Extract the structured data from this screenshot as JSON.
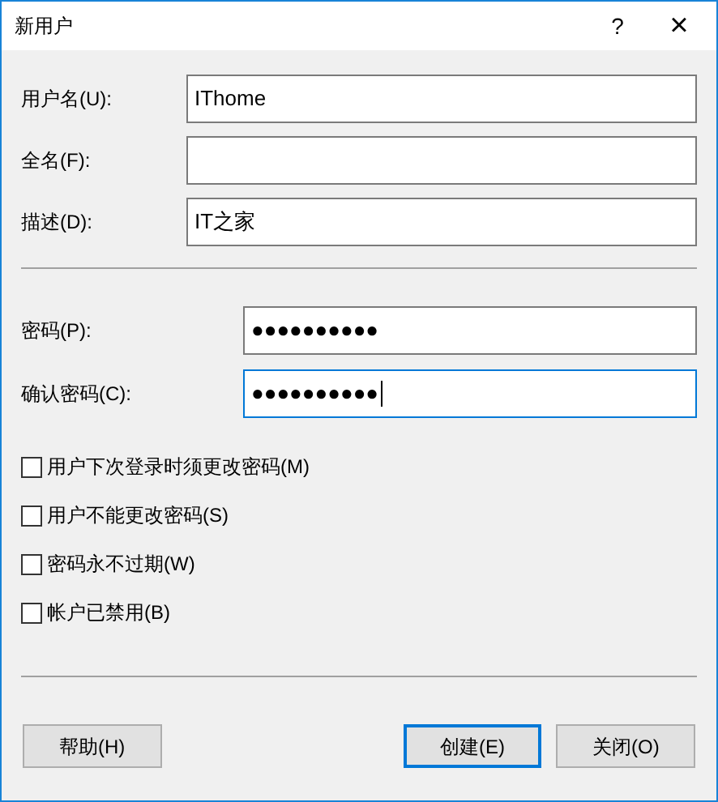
{
  "window": {
    "title": "新用户",
    "help_button": "?",
    "close_button": "×"
  },
  "account_fields": [
    {
      "label": "用户名(U):",
      "value": "IThome",
      "focused": false
    },
    {
      "label": "全名(F):",
      "focused": false
    },
    {
      "label": "描述(D):",
      "value": "IT之家",
      "focused": false
    }
  ],
  "password_fields": [
    {
      "label": "密码(P):",
      "value": "●●●●●●●●●●",
      "focused": false
    },
    {
      "label": "确认密码(C):",
      "value": "●●●●●●●●●●",
      "focused": true
    }
  ],
  "options": [
    {
      "label": "用户下次登录时须更改密码(M)",
      "checked": false
    },
    {
      "label": "用户不能更改密码(S)",
      "checked": false
    },
    {
      "label": "密码永不过期(W)",
      "checked": false
    },
    {
      "label": "帐户已禁用(B)",
      "checked": false
    }
  ],
  "buttons": [
    {
      "label": "帮助(H)",
      "default": false
    },
    {
      "label": "创建(E)",
      "default": true
    },
    {
      "label": "关闭(O)",
      "default": false
    }
  ]
}
